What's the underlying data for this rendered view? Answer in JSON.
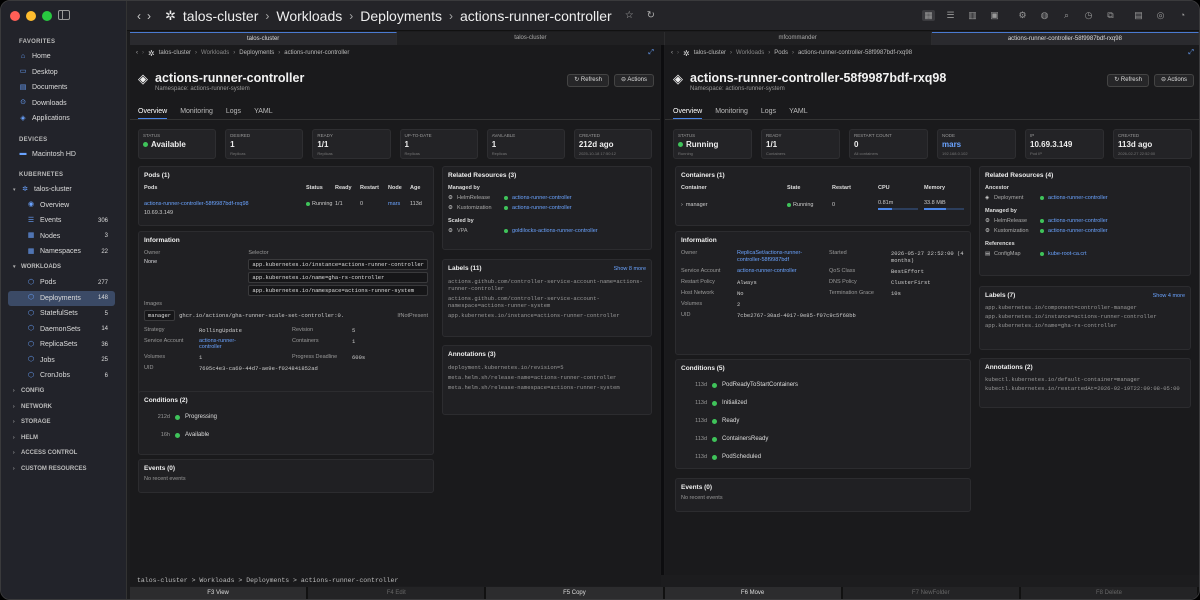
{
  "colors": {
    "accent": "#6aa3ff",
    "running": "#3fc35a",
    "close": "#ff5f57",
    "minimize": "#febc2e",
    "zoom": "#28c840"
  },
  "sidebar": {
    "favorites_label": "FAVORITES",
    "favorites": [
      {
        "label": "Home",
        "icon": "home-icon"
      },
      {
        "label": "Desktop",
        "icon": "desktop-icon"
      },
      {
        "label": "Documents",
        "icon": "documents-icon"
      },
      {
        "label": "Downloads",
        "icon": "downloads-icon"
      },
      {
        "label": "Applications",
        "icon": "applications-icon"
      }
    ],
    "devices_label": "DEVICES",
    "devices": [
      {
        "label": "Macintosh HD",
        "icon": "disk-icon"
      }
    ],
    "kubernetes_label": "KUBERNETES",
    "cluster": "talos-cluster",
    "cluster_items": [
      {
        "label": "Overview",
        "count": ""
      },
      {
        "label": "Events",
        "count": "306"
      },
      {
        "label": "Nodes",
        "count": "3"
      },
      {
        "label": "Namespaces",
        "count": "22"
      }
    ],
    "workloads_label": "WORKLOADS",
    "workloads": [
      {
        "label": "Pods",
        "count": "277"
      },
      {
        "label": "Deployments",
        "count": "148"
      },
      {
        "label": "StatefulSets",
        "count": "5"
      },
      {
        "label": "DaemonSets",
        "count": "14"
      },
      {
        "label": "ReplicaSets",
        "count": "36"
      },
      {
        "label": "Jobs",
        "count": "25"
      },
      {
        "label": "CronJobs",
        "count": "6"
      }
    ],
    "groups": [
      "CONFIG",
      "NETWORK",
      "STORAGE",
      "HELM",
      "ACCESS CONTROL",
      "CUSTOM RESOURCES"
    ]
  },
  "titlebar": {
    "cluster": "talos-cluster",
    "section": "Workloads",
    "kind": "Deployments",
    "name": "actions-runner-controller"
  },
  "tabs": [
    "talos-cluster",
    "talos-cluster",
    "mfcommander",
    "actions-runner-controller-58f9987bdf-rxq98"
  ],
  "left": {
    "crumb": [
      "talos-cluster",
      "Workloads",
      "Deployments",
      "actions-runner-controller"
    ],
    "title": "actions-runner-controller",
    "namespace": "Namespace: actions-runner-system",
    "refresh": "Refresh",
    "actions": "Actions",
    "tabs": [
      "Overview",
      "Monitoring",
      "Logs",
      "YAML"
    ],
    "stats": [
      {
        "k": "Status",
        "v": "Available",
        "s": ""
      },
      {
        "k": "Desired",
        "v": "1",
        "s": "Replicas"
      },
      {
        "k": "Ready",
        "v": "1/1",
        "s": "Replicas"
      },
      {
        "k": "Up-to-date",
        "v": "1",
        "s": "Replicas"
      },
      {
        "k": "Available",
        "v": "1",
        "s": "Replicas"
      },
      {
        "k": "Created",
        "v": "212d ago",
        "s": "2025-10-18 17:50:12"
      }
    ],
    "pods_title": "Pods (1)",
    "pods_headers": [
      "Pods",
      "Status",
      "Ready",
      "Restart",
      "Node",
      "Age"
    ],
    "pod": {
      "name": "actions-runner-controller-58f9987bdf-rxq98",
      "ip": "10.69.3.149",
      "status": "Running",
      "ready": "1/1",
      "restart": "0",
      "node": "mars",
      "age": "113d"
    },
    "info_title": "Information",
    "owner_label": "Owner",
    "owner": "None",
    "selector_label": "Selector",
    "selectors": [
      "app.kubernetes.io/instance=actions-runner-controller",
      "app.kubernetes.io/name=gha-rs-controller",
      "app.kubernetes.io/namespace=actions-runner-system"
    ],
    "images_label": "Images",
    "container_tag": "manager",
    "image": "ghcr.io/actions/gha-runner-scale-set-controller:0.",
    "pull": "IfNotPresent",
    "strategy_label": "Strategy",
    "strategy": "RollingUpdate",
    "revision_label": "Revision",
    "revision": "5",
    "sa_label": "Service Account",
    "sa": "actions-runner-controller",
    "containers_label": "Containers",
    "containers": "1",
    "volumes_label": "Volumes",
    "volumes": "1",
    "pd_label": "Progress Deadline",
    "pd": "600s",
    "uid_label": "UID",
    "uid": "7695c4e3-ca69-44d7-ae9e-f024841852ad",
    "cond_title": "Conditions (2)",
    "conditions": [
      {
        "age": "212d",
        "name": "Progressing"
      },
      {
        "age": "16h",
        "name": "Available"
      }
    ],
    "events_title": "Events (0)",
    "events_empty": "No recent events",
    "related_title": "Related Resources (3)",
    "managed_by": "Managed by",
    "managed": [
      {
        "kind": "HelmRelease",
        "name": "actions-runner-controller"
      },
      {
        "kind": "Kustomization",
        "name": "actions-runner-controller"
      }
    ],
    "scaled_by": "Scaled by",
    "scaled": {
      "kind": "VPA",
      "name": "goldilocks-actions-runner-controller"
    },
    "labels_title": "Labels (11)",
    "labels_more": "Show 8 more",
    "labels": [
      "actions.github.com/controller-service-account-name=actions-runner-controller",
      "actions.github.com/controller-service-account-namespace=actions-runner-system",
      "app.kubernetes.io/instance=actions-runner-controller"
    ],
    "ann_title": "Annotations (3)",
    "annotations": [
      "deployment.kubernetes.io/revision=5",
      "meta.helm.sh/release-name=actions-runner-controller",
      "meta.helm.sh/release-namespace=actions-runner-system"
    ]
  },
  "right": {
    "crumb": [
      "talos-cluster",
      "Workloads",
      "Pods",
      "actions-runner-controller-58f9987bdf-rxq98"
    ],
    "title": "actions-runner-controller-58f9987bdf-rxq98",
    "namespace": "Namespace: actions-runner-system",
    "refresh": "Refresh",
    "actions": "Actions",
    "tabs": [
      "Overview",
      "Monitoring",
      "Logs",
      "YAML"
    ],
    "stats": [
      {
        "k": "Status",
        "v": "Running",
        "s": "Running"
      },
      {
        "k": "Ready",
        "v": "1/1",
        "s": "Containers"
      },
      {
        "k": "Restart count",
        "v": "0",
        "s": "All containers"
      },
      {
        "k": "Node",
        "v": "mars",
        "s": "192.168.0.102"
      },
      {
        "k": "IP",
        "v": "10.69.3.149",
        "s": "Pod IP"
      },
      {
        "k": "Created",
        "v": "113d ago",
        "s": "2026-02-27 22:52:00"
      }
    ],
    "containers_title": "Containers (1)",
    "c_headers": [
      "Container",
      "State",
      "Restart",
      "CPU",
      "Memory"
    ],
    "container": {
      "name": "manager",
      "state": "Running",
      "restart": "0",
      "cpu": "0.81m",
      "mem": "33.8 MiB"
    },
    "cpu_fill": 0.35,
    "mem_fill": 0.55,
    "info_title": "Information",
    "owner_label": "Owner",
    "owner": "ReplicaSet/actions-runner-controller-58f9987bdf",
    "started_label": "Started",
    "started": "2026-05-27 22:52:00 (4 months)",
    "sa_label": "Service Account",
    "sa": "actions-runner-controller",
    "qos_label": "QoS Class",
    "qos": "BestEffort",
    "rp_label": "Restart Policy",
    "rp": "Always",
    "dns_label": "DNS Policy",
    "dns": "ClusterFirst",
    "hn_label": "Host Network",
    "hn": "No",
    "tg_label": "Termination Grace",
    "tg": "10s",
    "vol_label": "Volumes",
    "vol": "2",
    "uid_label": "UID",
    "uid": "7cbe2767-30ad-4017-9e85-f07c9c5f68bb",
    "cond_title": "Conditions (5)",
    "conditions": [
      {
        "age": "113d",
        "name": "PodReadyToStartContainers"
      },
      {
        "age": "113d",
        "name": "Initialized"
      },
      {
        "age": "113d",
        "name": "Ready"
      },
      {
        "age": "113d",
        "name": "ContainersReady"
      },
      {
        "age": "113d",
        "name": "PodScheduled"
      }
    ],
    "events_title": "Events (0)",
    "events_empty": "No recent events",
    "related_title": "Related Resources (4)",
    "ancestor": "Ancestor",
    "ancestor_item": {
      "kind": "Deployment",
      "name": "actions-runner-controller"
    },
    "managed_by": "Managed by",
    "managed": [
      {
        "kind": "HelmRelease",
        "name": "actions-runner-controller"
      },
      {
        "kind": "Kustomization",
        "name": "actions-runner-controller"
      }
    ],
    "references": "References",
    "ref": {
      "kind": "ConfigMap",
      "name": "kube-root-ca.crt"
    },
    "labels_title": "Labels (7)",
    "labels_more": "Show 4 more",
    "labels": [
      "app.kubernetes.io/component=controller-manager",
      "app.kubernetes.io/instance=actions-runner-controller",
      "app.kubernetes.io/name=gha-rs-controller"
    ],
    "ann_title": "Annotations (2)",
    "annotations": [
      "kubectl.kubernetes.io/default-container=manager",
      "kubectl.kubernetes.io/restartedAt=2026-02-19T22:09:08-05:00"
    ]
  },
  "bottom_crumb": "talos-cluster > Workloads > Deployments > actions-runner-controller",
  "fkeys": [
    {
      "label": "F3 View",
      "dim": false
    },
    {
      "label": "F4 Edit",
      "dim": true
    },
    {
      "label": "F5 Copy",
      "dim": false
    },
    {
      "label": "F6 Move",
      "dim": false
    },
    {
      "label": "F7 NewFolder",
      "dim": true
    },
    {
      "label": "F8 Delete",
      "dim": true
    }
  ]
}
